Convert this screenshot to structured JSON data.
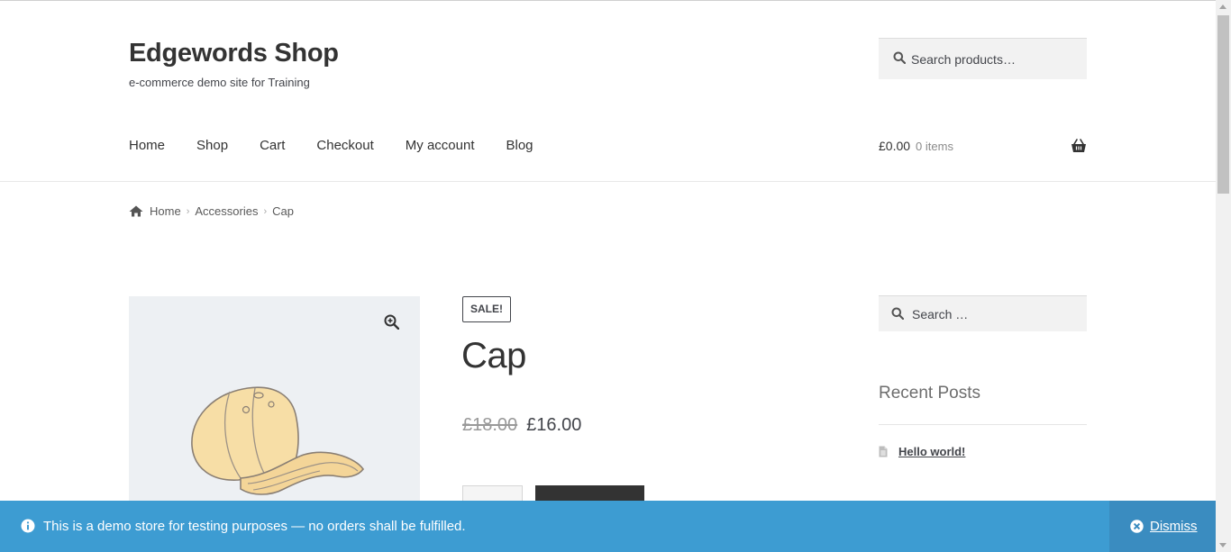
{
  "site": {
    "title": "Edgewords Shop",
    "tagline": "e-commerce demo site for Training"
  },
  "header_search": {
    "placeholder": "Search products…"
  },
  "nav": {
    "items": [
      {
        "label": "Home"
      },
      {
        "label": "Shop"
      },
      {
        "label": "Cart"
      },
      {
        "label": "Checkout"
      },
      {
        "label": "My account"
      },
      {
        "label": "Blog"
      }
    ]
  },
  "mini_cart": {
    "amount": "£0.00",
    "count": "0 items",
    "icon": "basket-icon"
  },
  "breadcrumb": {
    "icon": "home-icon",
    "items": [
      {
        "label": "Home"
      },
      {
        "label": "Accessories"
      },
      {
        "label": "Cap"
      }
    ]
  },
  "product": {
    "sale_badge": "SALE!",
    "title": "Cap",
    "regular_price": "£18.00",
    "sale_price": "£16.00",
    "zoom_icon": "zoom-in-icon",
    "image_icon": "cap-image"
  },
  "sidebar": {
    "search_placeholder": "Search …",
    "recent_posts_title": "Recent Posts",
    "posts": [
      {
        "label": "Hello world!"
      }
    ]
  },
  "notice": {
    "message": "This is a demo store for testing purposes — no orders shall be fulfilled.",
    "dismiss_label": "Dismiss",
    "background": "#3d9cd2"
  }
}
